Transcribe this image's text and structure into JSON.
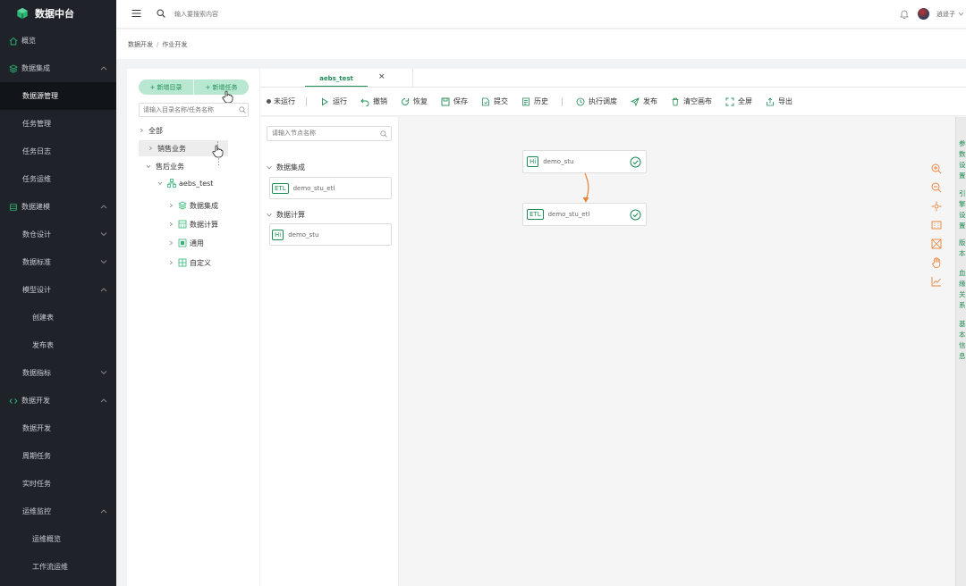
{
  "app": {
    "title": "数据中台"
  },
  "sidebar": {
    "items": [
      {
        "label": "概览"
      },
      {
        "label": "数据集成"
      },
      {
        "label": "数据源管理"
      },
      {
        "label": "任务管理"
      },
      {
        "label": "任务日志"
      },
      {
        "label": "任务运维"
      },
      {
        "label": "数据建模"
      },
      {
        "label": "数仓设计"
      },
      {
        "label": "数据标准"
      },
      {
        "label": "模型设计"
      },
      {
        "label": "创建表"
      },
      {
        "label": "发布表"
      },
      {
        "label": "数据指标"
      },
      {
        "label": "数据开发"
      },
      {
        "label": "数据开发"
      },
      {
        "label": "周期任务"
      },
      {
        "label": "实时任务"
      },
      {
        "label": "运维监控"
      },
      {
        "label": "运维概览"
      },
      {
        "label": "工作流运维"
      }
    ]
  },
  "topbar": {
    "search_placeholder": "输入要搜索内容",
    "user_name": "逍遥子"
  },
  "breadcrumb": {
    "parent": "数据开发",
    "separator": "/",
    "current": "作业开发"
  },
  "tree": {
    "add_dir": "+ 新增目录",
    "add_task": "+ 新增任务",
    "search_placeholder": "请输入目录名称/任务名称",
    "nodes": [
      {
        "label": "全部"
      },
      {
        "label": "销售业务"
      },
      {
        "label": "售后业务"
      },
      {
        "label": "aebs_test"
      },
      {
        "label": "数据集成"
      },
      {
        "label": "数据计算"
      },
      {
        "label": "通用"
      },
      {
        "label": "自定义"
      }
    ]
  },
  "tab": {
    "label": "aebs_test",
    "close": "×"
  },
  "toolbar": {
    "status": "未运行",
    "buttons": [
      {
        "label": "运行"
      },
      {
        "label": "撤销"
      },
      {
        "label": "恢复"
      },
      {
        "label": "保存"
      },
      {
        "label": "提交"
      },
      {
        "label": "历史"
      },
      {
        "label": "执行调度"
      },
      {
        "label": "发布"
      },
      {
        "label": "清空画布"
      },
      {
        "label": "全屏"
      },
      {
        "label": "导出"
      }
    ]
  },
  "palette": {
    "search_placeholder": "请输入节点名称",
    "groups": [
      {
        "label": "数据集成",
        "items": [
          {
            "badge": "ETL",
            "label": "demo_stu_etl"
          }
        ]
      },
      {
        "label": "数据计算",
        "items": [
          {
            "badge": "Hi",
            "label": "demo_stu"
          }
        ]
      }
    ]
  },
  "canvas": {
    "nodes": [
      {
        "badge": "Hi",
        "label": "demo_stu"
      },
      {
        "badge": "ETL",
        "label": "demo_stu_etl"
      }
    ]
  },
  "right_rail": {
    "tabs": [
      "参数设置",
      "引擎设置",
      "版本",
      "血缘关系",
      "基本信息"
    ]
  },
  "colors": {
    "sidebar_bg": "#1f2329",
    "accent": "#1e8c55",
    "accent_light": "#b9e8d2",
    "tool_orange": "#e8833a"
  }
}
